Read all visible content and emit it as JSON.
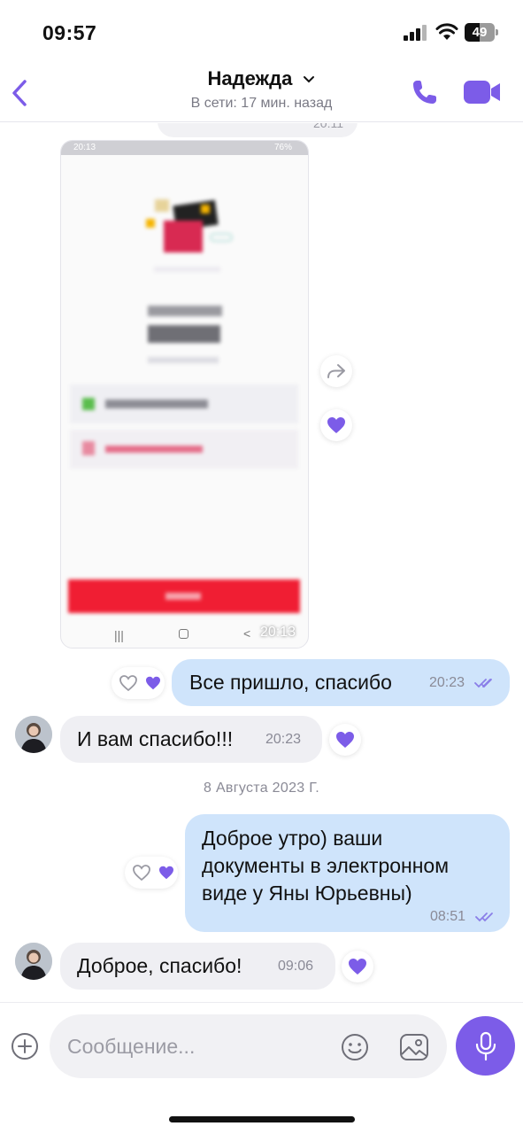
{
  "status_bar": {
    "time": "09:57",
    "battery": "49",
    "battery_level": 0.49
  },
  "header": {
    "contact_name": "Надежда",
    "contact_status": "В сети: 17 мин. назад"
  },
  "messages": {
    "previous_time": "20:11",
    "image": {
      "time": "20:13",
      "status_time": "20:13",
      "status_battery": "76%"
    },
    "m1": {
      "text": "Все пришло, спасибо",
      "time": "20:23"
    },
    "m2": {
      "text": "И вам спасибо!!!",
      "time": "20:23"
    },
    "date_separator": "8 Августа 2023 Г.",
    "m3": {
      "lines": [
        "Доброе утро) ваши",
        "документы в электронном",
        "виде у Яны Юрьевны)"
      ],
      "time": "08:51"
    },
    "m4": {
      "text": "Доброе, спасибо!",
      "time": "09:06"
    }
  },
  "composer": {
    "placeholder": "Сообщение..."
  },
  "colors": {
    "accent": "#7c5ce8",
    "outgoing_bubble": "#cfe4fb",
    "incoming_bubble": "#efeff3"
  }
}
